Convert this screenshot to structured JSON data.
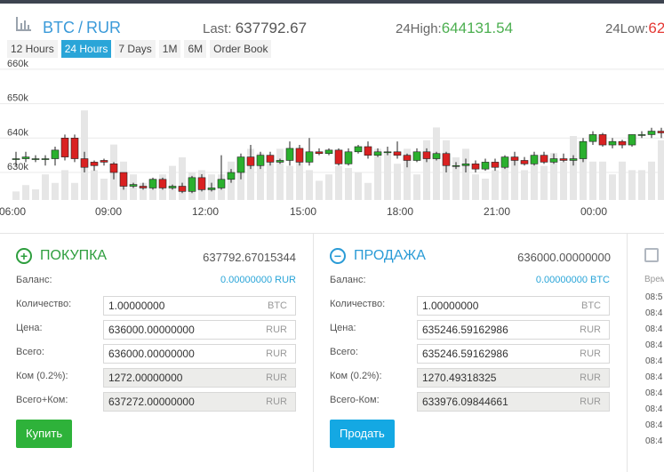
{
  "header": {
    "pair_base": "BTC",
    "pair_sep": "/",
    "pair_quote": "RUR",
    "last_label": "Last:",
    "last_value": "637792.67",
    "high_label": "24High:",
    "high_value": "644131.54",
    "low_label": "24Low:",
    "low_value": "62"
  },
  "tabs": [
    "12 Hours",
    "24 Hours",
    "7 Days",
    "1M",
    "6M",
    "Order Book"
  ],
  "active_tab": "24 Hours",
  "colors": {
    "up": "#2bb02e",
    "down": "#d92121",
    "volume": "#e6e6e6",
    "grid": "#e9e9e9",
    "accent": "#2aa5d8"
  },
  "chart_data": {
    "type": "candlestick",
    "y_ticks": [
      "660k",
      "650k",
      "640k",
      "630k"
    ],
    "x_ticks": [
      "06:00",
      "09:00",
      "12:00",
      "15:00",
      "18:00",
      "21:00",
      "00:00"
    ],
    "ylim": [
      622000,
      661000
    ],
    "candles": [
      [
        634000,
        634000,
        636000,
        632000,
        4
      ],
      [
        634000,
        634500,
        636000,
        633000,
        7
      ],
      [
        634000,
        634000,
        635000,
        633000,
        5
      ],
      [
        634000,
        634000,
        635000,
        632000,
        12
      ],
      [
        634000,
        636500,
        637500,
        632000,
        8
      ],
      [
        640000,
        634500,
        641000,
        633500,
        14
      ],
      [
        640000,
        634000,
        641000,
        633000,
        8
      ],
      [
        634000,
        631500,
        636000,
        630000,
        42
      ],
      [
        633000,
        632000,
        633500,
        630500,
        14
      ],
      [
        633500,
        633000,
        634000,
        632000,
        10
      ],
      [
        632500,
        630000,
        633000,
        628000,
        26
      ],
      [
        630000,
        626000,
        630000,
        625000,
        18
      ],
      [
        626000,
        626500,
        627000,
        625500,
        12
      ],
      [
        626000,
        625500,
        627000,
        625000,
        8
      ],
      [
        625500,
        628000,
        628500,
        625000,
        10
      ],
      [
        628000,
        625500,
        628500,
        625000,
        12
      ],
      [
        625500,
        626000,
        626500,
        625000,
        16
      ],
      [
        626000,
        624500,
        627000,
        624000,
        20
      ],
      [
        624500,
        628500,
        629000,
        624000,
        13
      ],
      [
        628500,
        625000,
        629500,
        624500,
        14
      ],
      [
        625000,
        625500,
        627000,
        624500,
        12
      ],
      [
        625500,
        628000,
        635000,
        625000,
        12
      ],
      [
        628000,
        630000,
        631000,
        627000,
        18
      ],
      [
        630000,
        634500,
        635500,
        628000,
        16
      ],
      [
        634500,
        632000,
        638000,
        631000,
        24
      ],
      [
        632000,
        635000,
        636000,
        631000,
        22
      ],
      [
        635000,
        633000,
        636000,
        632000,
        18
      ],
      [
        633000,
        633500,
        634000,
        632500,
        24
      ],
      [
        633500,
        637000,
        639000,
        632000,
        16
      ],
      [
        637000,
        633000,
        638000,
        632000,
        20
      ],
      [
        633000,
        636000,
        640000,
        632000,
        14
      ],
      [
        636000,
        635500,
        637000,
        635000,
        9
      ],
      [
        635500,
        636500,
        637000,
        635000,
        12
      ],
      [
        636500,
        632500,
        637000,
        632000,
        16
      ],
      [
        632500,
        636000,
        637000,
        632000,
        15
      ],
      [
        636000,
        637500,
        638000,
        635500,
        13
      ],
      [
        637500,
        635000,
        639000,
        634000,
        8
      ],
      [
        635000,
        636000,
        637000,
        634500,
        24
      ],
      [
        636000,
        636000,
        637500,
        635000,
        22
      ],
      [
        636000,
        635000,
        639000,
        634000,
        17
      ],
      [
        635000,
        633500,
        635500,
        631500,
        24
      ],
      [
        633500,
        636000,
        637000,
        633000,
        12
      ],
      [
        636000,
        634000,
        637000,
        633000,
        28
      ],
      [
        634000,
        635500,
        636000,
        633500,
        34
      ],
      [
        635500,
        632000,
        636000,
        630000,
        28
      ],
      [
        632000,
        632000,
        633000,
        631000,
        20
      ],
      [
        632000,
        632500,
        634000,
        630000,
        24
      ],
      [
        632500,
        631000,
        633500,
        630000,
        12
      ],
      [
        631000,
        633000,
        634000,
        630500,
        10
      ],
      [
        633000,
        631500,
        634000,
        630500,
        14
      ],
      [
        631500,
        634500,
        635000,
        631000,
        16
      ],
      [
        634500,
        633500,
        636000,
        632000,
        20
      ],
      [
        633500,
        632500,
        634500,
        632000,
        14
      ],
      [
        632500,
        635000,
        636000,
        632000,
        18
      ],
      [
        635000,
        633000,
        636000,
        632500,
        16
      ],
      [
        633000,
        634000,
        635500,
        632500,
        22
      ],
      [
        634000,
        633500,
        635500,
        633000,
        18
      ],
      [
        633500,
        634000,
        635000,
        632000,
        30
      ],
      [
        634000,
        639000,
        640000,
        633000,
        25
      ],
      [
        639000,
        641000,
        642000,
        638000,
        18
      ],
      [
        641000,
        638000,
        641500,
        637500,
        18
      ],
      [
        638000,
        639000,
        640000,
        637000,
        12
      ],
      [
        639000,
        638000,
        639500,
        637000,
        18
      ],
      [
        638000,
        641000,
        641000,
        637500,
        14
      ],
      [
        641000,
        641000,
        642000,
        640000,
        14
      ],
      [
        641000,
        642000,
        643000,
        640000,
        18
      ],
      [
        642000,
        641500,
        643000,
        640000,
        28
      ],
      [
        641500,
        642000,
        643000,
        641000,
        14
      ],
      [
        642000,
        640000,
        643000,
        639000,
        16
      ],
      [
        640000,
        640000,
        641000,
        639000,
        18
      ],
      [
        640000,
        640500,
        641500,
        639000,
        24
      ],
      [
        640500,
        640500,
        641000,
        640000,
        16
      ],
      [
        640500,
        638000,
        641000,
        637500,
        40
      ],
      [
        638000,
        640000,
        641000,
        637500,
        30
      ],
      [
        640000,
        640000,
        640500,
        639000,
        14
      ],
      [
        640000,
        638000,
        641000,
        637000,
        28
      ],
      [
        638000,
        640500,
        641000,
        637500,
        24
      ]
    ]
  },
  "buy": {
    "title": "ПОКУПКА",
    "price": "637792.67015344",
    "balance_label": "Баланс:",
    "balance_value": "0.00000000 RUR",
    "fields": [
      {
        "label": "Количество:",
        "value": "1.00000000",
        "currency": "BTC"
      },
      {
        "label": "Цена:",
        "value": "636000.00000000",
        "currency": "RUR"
      },
      {
        "label": "Всего:",
        "value": "636000.00000000",
        "currency": "RUR"
      },
      {
        "label": "Ком (0.2%):",
        "value": "1272.00000000",
        "currency": "RUR"
      },
      {
        "label": "Всего+Ком:",
        "value": "637272.00000000",
        "currency": "RUR"
      }
    ],
    "button": "Купить"
  },
  "sell": {
    "title": "ПРОДАЖА",
    "price": "636000.00000000",
    "balance_label": "Баланс:",
    "balance_value": "0.00000000 BTC",
    "fields": [
      {
        "label": "Количество:",
        "value": "1.00000000",
        "currency": "BTC"
      },
      {
        "label": "Цена:",
        "value": "635246.59162986",
        "currency": "RUR"
      },
      {
        "label": "Всего:",
        "value": "635246.59162986",
        "currency": "RUR"
      },
      {
        "label": "Ком (0.2%):",
        "value": "1270.49318325",
        "currency": "RUR"
      },
      {
        "label": "Всего-Ком:",
        "value": "633976.09844661",
        "currency": "RUR"
      }
    ],
    "button": "Продать"
  },
  "history": {
    "header": "Врем",
    "times": [
      "08:5",
      "08:4",
      "08:4",
      "08:4",
      "08:4",
      "08:4",
      "08:4",
      "08:4",
      "08:4",
      "08:4"
    ]
  }
}
